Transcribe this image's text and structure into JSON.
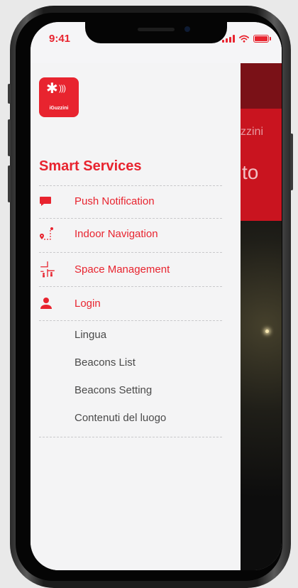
{
  "status_bar": {
    "time": "9:41"
  },
  "background": {
    "fragment_top": "zzini",
    "fragment_big": "to"
  },
  "drawer": {
    "logo": {
      "brand": "iGuzzini"
    },
    "section_title": "Smart Services",
    "primary_items": [
      {
        "label": "Push Notification",
        "icon": "chat-bubble-icon"
      },
      {
        "label": "Indoor Navigation",
        "icon": "route-pin-icon"
      },
      {
        "label": "Space Management",
        "icon": "room-people-icon"
      },
      {
        "label": "Login",
        "icon": "user-icon"
      }
    ],
    "secondary_items": [
      {
        "label": "Lingua"
      },
      {
        "label": "Beacons List"
      },
      {
        "label": "Beacons Setting"
      },
      {
        "label": "Contenuti del luogo"
      }
    ]
  },
  "colors": {
    "accent": "#e8242f",
    "drawer_bg": "#f4f4f5",
    "text_secondary": "#4a4a4a"
  }
}
